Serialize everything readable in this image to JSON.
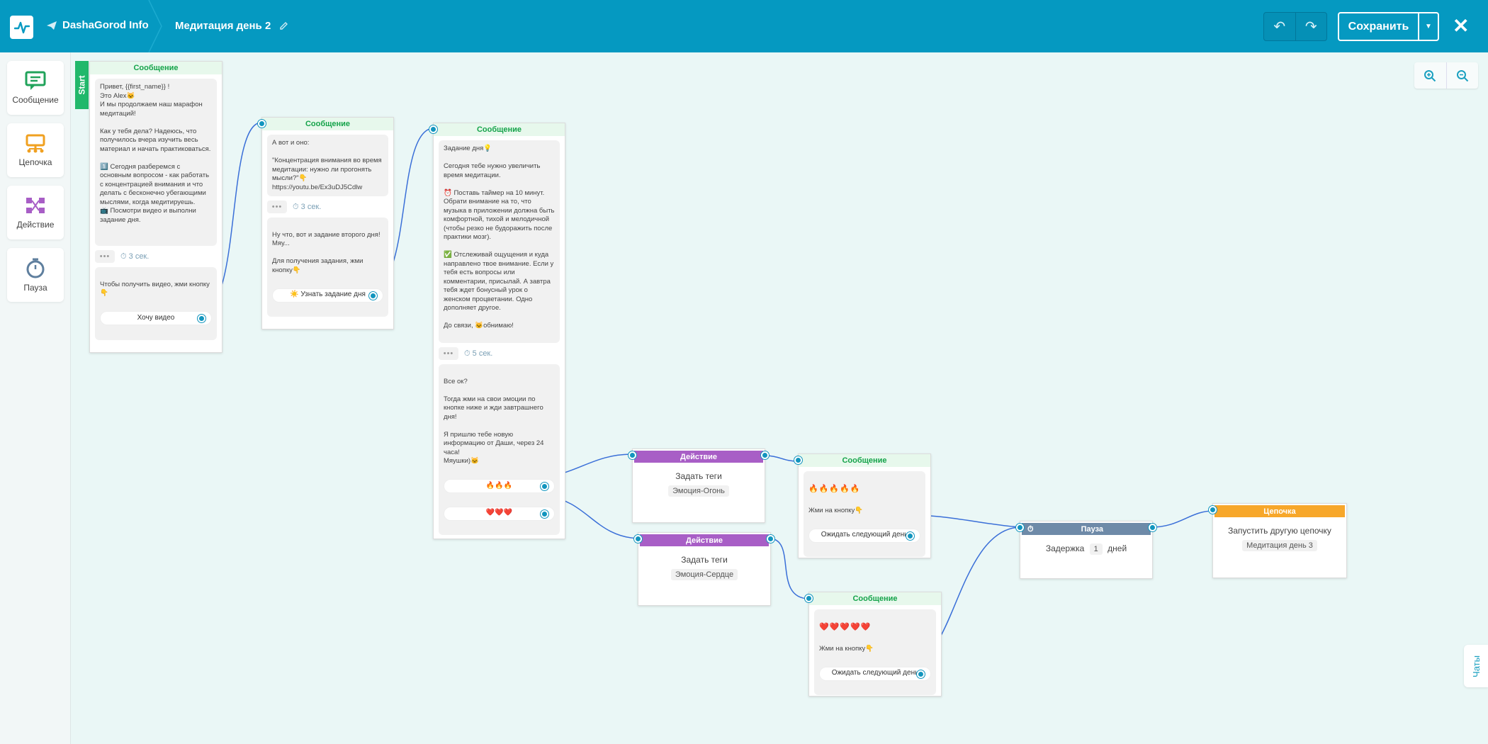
{
  "header": {
    "project": "DashaGorod Info",
    "title": "Медитация день 2",
    "save_label": "Сохранить"
  },
  "tools": [
    {
      "label": "Сообщение",
      "icon": "message-icon",
      "color": "#21a35b"
    },
    {
      "label": "Цепочка",
      "icon": "chain-icon",
      "color": "#f0a020"
    },
    {
      "label": "Действие",
      "icon": "action-icon",
      "color": "#a85ec6"
    },
    {
      "label": "Пауза",
      "icon": "timer-icon",
      "color": "#5f7f9e"
    }
  ],
  "chats_tab": "Чаты",
  "nodes": {
    "start_label": "Start",
    "msg1": {
      "title": "Сообщение",
      "text": "Привет, {{first_name}} !\nЭто Alex🐱\nИ мы продолжаем наш марафон медитаций!\n\nКак у тебя дела? Надеюсь, что получилось вчера изучить весь материал и начать практиковаться.\n\n1️⃣ Сегодня разберемся с основным вопросом - как работать с концентрацией внимания и что делать с бесконечно убегающими мыслями, когда медитируешь.\n📺 Посмотри видео и выполни задание дня.",
      "delay": "3 сек.",
      "text2": "Чтобы получить видео, жми кнопку👇",
      "button": "Хочу видео"
    },
    "msg2": {
      "title": "Сообщение",
      "text": "А вот и оно:\n\n\"Концентрация внимания во время медитации: нужно ли прогонять мысли?\"👇\nhttps://youtu.be/Ex3uDJ5Cdlw",
      "delay": "3 сек.",
      "text2": "Ну что, вот и задание второго дня! Мяу...\n\nДля получения задания, жми кнопку👇",
      "button": "☀️ Узнать задание дня"
    },
    "msg3": {
      "title": "Сообщение",
      "text": "Задание дня💡\n\nСегодня тебе нужно увеличить время медитации.\n\n⏰ Поставь таймер на 10 минут. Обрати внимание на то, что музыка в приложении должна быть комфортной, тихой и мелодичной (чтобы резко не будоражить после практики мозг).\n\n✅ Отслеживай ощущения и куда направлено твое внимание. Если у тебя есть вопросы или комментарии, присылай. А завтра тебя ждет бонусный урок о женском процветании. Одно дополняет другое.\n\nДо связи, 🐱обнимаю!",
      "delay": "5 сек.",
      "text2": "Все ок?\n\nТогда жми на свои эмоции по кнопке ниже и жди завтрашнего дня!\n\nЯ пришлю тебе новую информацию от Даши, через 24 часа!\nМяушки)🐱",
      "button1": "🔥🔥🔥",
      "button2": "❤️❤️❤️"
    },
    "action1": {
      "title": "Действие",
      "text": "Задать теги",
      "tag": "Эмоция-Огонь"
    },
    "action2": {
      "title": "Действие",
      "text": "Задать теги",
      "tag": "Эмоция-Сердце"
    },
    "msg4": {
      "title": "Сообщение",
      "emoji": "🔥🔥🔥🔥🔥",
      "text": "Жми на кнопку👇",
      "button": "Ожидать следующий день"
    },
    "msg5": {
      "title": "Сообщение",
      "emoji": "❤️❤️❤️❤️❤️",
      "text": "Жми на кнопку👇",
      "button": "Ожидать следующий день"
    },
    "pause": {
      "title": "Пауза",
      "prefix": "Задержка",
      "value": "1",
      "unit": "дней"
    },
    "chain": {
      "title": "Цепочка",
      "text": "Запустить другую цепочку",
      "tag": "Медитация день 3"
    }
  }
}
